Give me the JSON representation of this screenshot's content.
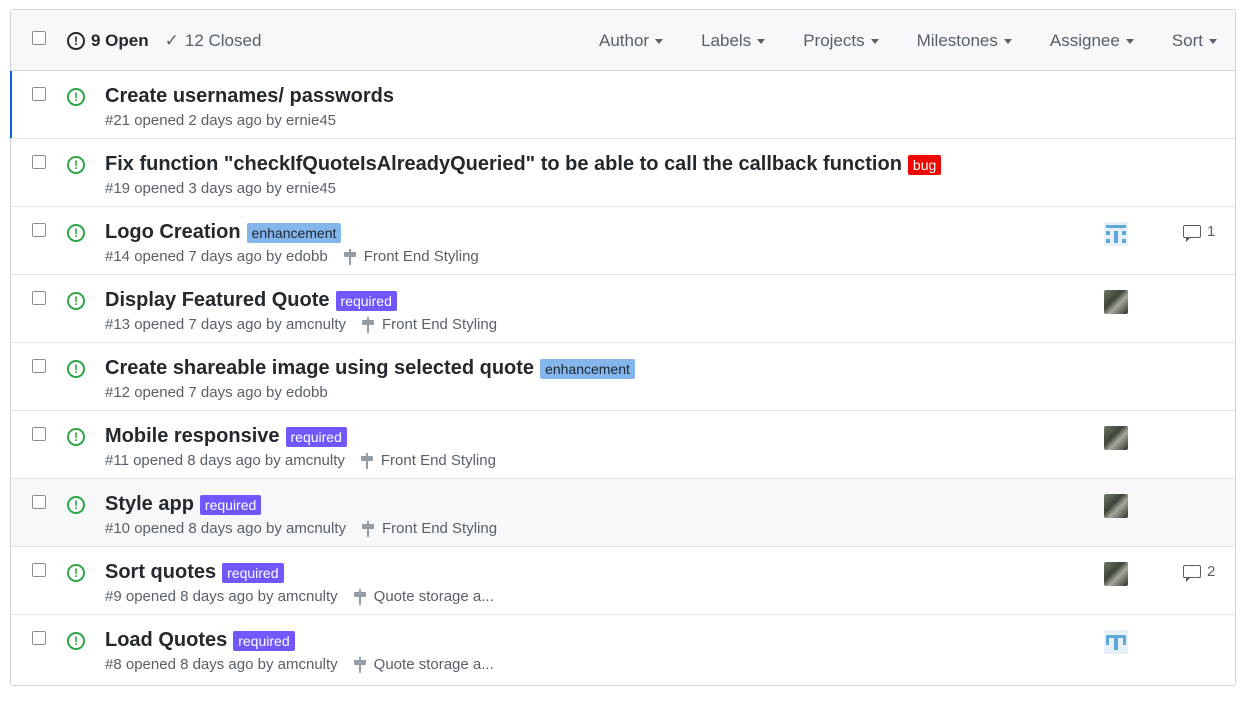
{
  "header": {
    "open_label": "9 Open",
    "closed_label": "12 Closed",
    "filters": [
      "Author",
      "Labels",
      "Projects",
      "Milestones",
      "Assignee",
      "Sort"
    ]
  },
  "colors": {
    "bug": "#ee0701",
    "enhancement": "#84b6eb",
    "required": "#7057ff",
    "open_icon": "#28a745"
  },
  "issues": [
    {
      "title": "Create usernames/ passwords",
      "meta": "#21 opened 2 days ago by ernie45"
    },
    {
      "title": "Fix function \"checkIfQuoteIsAlreadyQueried\" to be able to call the callback function",
      "label": "bug",
      "meta": "#19 opened 3 days ago by ernie45"
    },
    {
      "title": "Logo Creation",
      "label": "enhancement",
      "meta": "#14 opened 7 days ago by edobb",
      "milestone": "Front End Styling",
      "comments": "1",
      "assignee_icon": "identicon"
    },
    {
      "title": "Display Featured Quote",
      "label": "required",
      "meta": "#13 opened 7 days ago by amcnulty",
      "milestone": "Front End Styling",
      "assignee_icon": "photo-avatar"
    },
    {
      "title": "Create shareable image using selected quote",
      "label": "enhancement",
      "meta": "#12 opened 7 days ago by edobb"
    },
    {
      "title": "Mobile responsive",
      "label": "required",
      "meta": "#11 opened 8 days ago by amcnulty",
      "milestone": "Front End Styling",
      "assignee_icon": "photo-avatar"
    },
    {
      "title": "Style app",
      "label": "required",
      "meta": "#10 opened 8 days ago by amcnulty",
      "milestone": "Front End Styling",
      "assignee_icon": "photo-avatar"
    },
    {
      "title": "Sort quotes",
      "label": "required",
      "meta": "#9 opened 8 days ago by amcnulty",
      "milestone": "Quote storage a...",
      "comments": "2",
      "assignee_icon": "photo-avatar"
    },
    {
      "title": "Load Quotes",
      "label": "required",
      "meta": "#8 opened 8 days ago by amcnulty",
      "milestone": "Quote storage a...",
      "assignee_icon": "identicon"
    }
  ]
}
